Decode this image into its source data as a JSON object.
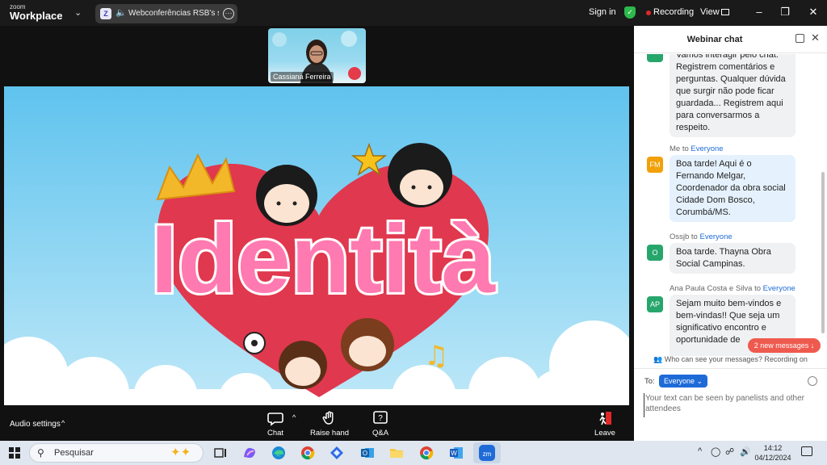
{
  "app": {
    "logo_small": "zoom",
    "logo_big": "Workplace",
    "tab_title": "Webconferências RSB's scree",
    "sign_in": "Sign in",
    "recording": "Recording",
    "view": "View"
  },
  "meeting": {
    "participant_name": "Cassiana Ferreira",
    "shared_title": "Identità",
    "audio_settings": "Audio settings",
    "toolbar": {
      "chat": "Chat",
      "raise_hand": "Raise hand",
      "qa": "Q&A",
      "leave": "Leave"
    }
  },
  "chat": {
    "title": "Webinar chat",
    "messages": [
      {
        "sender": "",
        "to": "",
        "avatar": "",
        "text": "Vamos interagir pelo chat. Registrem comentários e perguntas. Qualquer dúvida que surgir não pode ficar guardada... Registrem aqui para conversarmos a respeito."
      },
      {
        "sender": "Me to",
        "to": "Everyone",
        "avatar": "FM",
        "text": "Boa tarde! Aqui é o Fernando Melgar, Coordenador da obra social Cidade Dom Bosco, Corumbá/MS."
      },
      {
        "sender": "Ossjb to",
        "to": "Everyone",
        "avatar": "O",
        "text": "Boa tarde. Thayna Obra Social Campinas."
      },
      {
        "sender": "Ana Paula Costa e Silva to",
        "to": "Everyone",
        "avatar": "AP",
        "text": "Sejam muito bem-vindos e bem-vindas!! Que seja um significativo encontro e oportunidade de"
      }
    ],
    "new_messages": "2 new messages",
    "who_can_see": "Who can see your messages? Recording on",
    "to_label": "To:",
    "to_value": "Everyone",
    "input_placeholder": "Your text can be seen by panelists and other attendees"
  },
  "taskbar": {
    "search_placeholder": "Pesquisar",
    "time": "14:12",
    "date": "04/12/2024"
  },
  "colors": {
    "zoom_blue": "#1e6bd8",
    "recording_red": "#e02828",
    "new_messages_red": "#ef5a4f"
  },
  "icons": [
    "chat-icon",
    "raise-hand-icon",
    "qa-icon",
    "leave-icon",
    "search-icon",
    "windows-icon",
    "shield-check-icon",
    "popout-icon",
    "close-icon",
    "emoji-icon"
  ]
}
